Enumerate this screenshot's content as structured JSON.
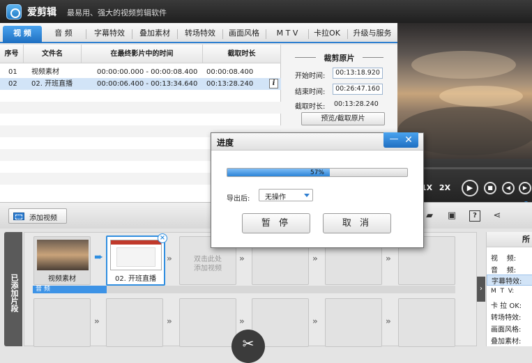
{
  "app": {
    "name": "爱剪辑",
    "slogan": "最易用、强大的视频剪辑软件"
  },
  "tabs": [
    "视 频",
    "音 频",
    "字幕特效",
    "叠加素材",
    "转场特效",
    "画面风格",
    "M T V",
    "卡拉OK",
    "升级与服务"
  ],
  "file_table": {
    "headers": [
      "序号",
      "文件名",
      "在最终影片中的时间",
      "截取时长"
    ],
    "rows": [
      {
        "index": "01",
        "name": "视频素材",
        "time": "00:00:00.000 - 00:00:08.400",
        "duration": "00:00:08.400"
      },
      {
        "index": "02",
        "name": "02. 开班直播",
        "time": "00:00:06.400 - 00:13:34.640",
        "duration": "00:13:28.240",
        "selected": true
      }
    ]
  },
  "trim": {
    "title": "裁剪原片",
    "start_label": "开始时间:",
    "start_value": "00:13:18.920",
    "end_label": "结束时间:",
    "end_value": "00:26:47.160",
    "duration_label": "截取时长:",
    "duration_value": "00:13:28.240",
    "preview_button": "预览/截取原片"
  },
  "player": {
    "speed_1x": "1X",
    "speed_2x": "2X",
    "volume": 0.96
  },
  "toolbar": {
    "add_video": "添加视频"
  },
  "sidetab": "已添加片段",
  "timeline": {
    "clips": [
      {
        "label": "视频素材"
      },
      {
        "label": "02. 开班直播"
      }
    ],
    "placeholder": "双击此处\n添加视频",
    "audio_label": "音 频"
  },
  "right_panel": {
    "header": "所",
    "rows": [
      "视    频:",
      "音    频:",
      "字幕特效:",
      "M  T  V:",
      "卡 拉 OK:",
      "转场特效:",
      "画面风格:",
      "叠加素材:"
    ]
  },
  "dialog": {
    "title": "进度",
    "progress": 0.57,
    "progress_text": "57%",
    "after_label": "导出后:",
    "after_value": "无操作",
    "pause": "暂 停",
    "cancel": "取 消"
  },
  "colors": {
    "accent": "#2f8ee0",
    "selection": "#d2e4f7"
  }
}
